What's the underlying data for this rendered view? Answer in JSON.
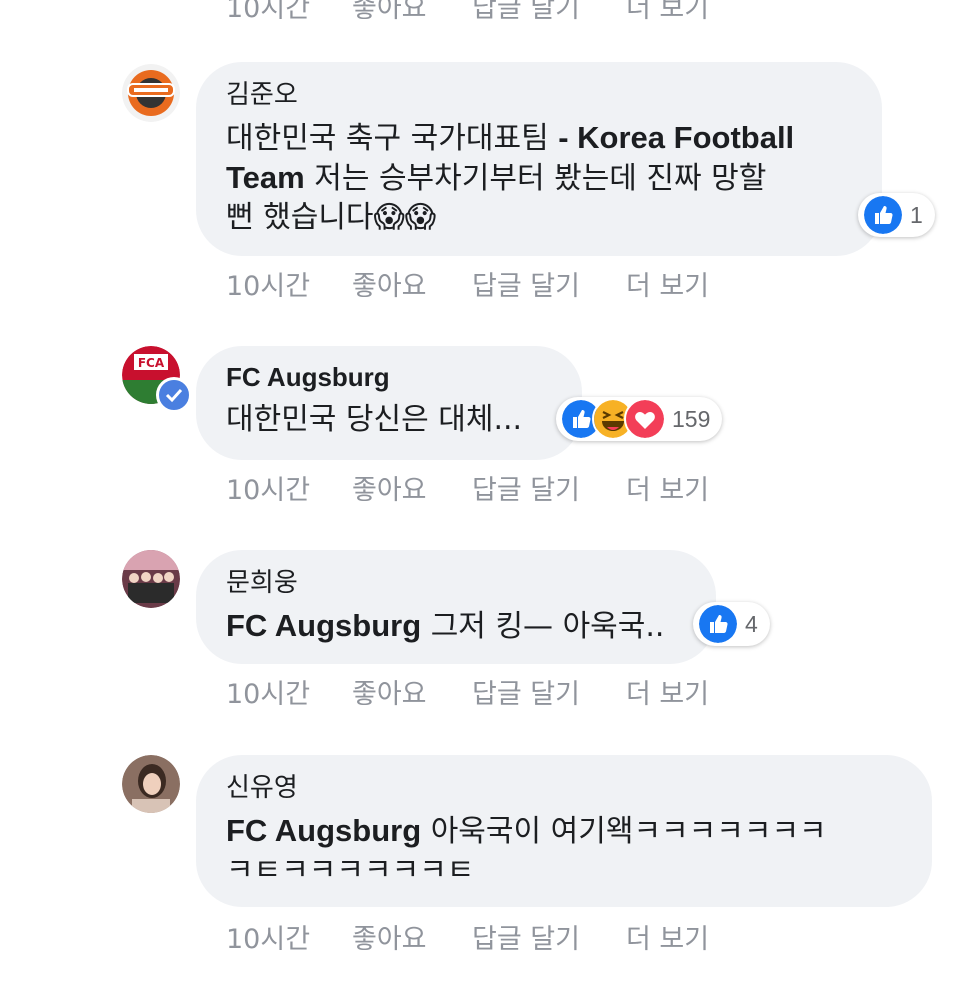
{
  "actions": {
    "time": "10시간",
    "like": "좋아요",
    "reply": "답글 달기",
    "more": "더 보기"
  },
  "comments": [
    {
      "author": "김준오",
      "tag": "대한민국 축구 국가대표팀 - Korea Football Team",
      "line1_plain": "대한민국 축구 국가대표팀 ",
      "line1_bold": "- Korea Football",
      "line2_bold": "Team",
      "line2_plain": " 저는 승부차기부터 봤는데 진짜 망할",
      "line3": "뻔 했습니다😱😱",
      "reaction_count": "1",
      "reactions": [
        "like-icon"
      ]
    },
    {
      "author": "FC Augsburg",
      "text": "대한민국 당신은 대체...",
      "reaction_count": "159",
      "reactions": [
        "like-icon",
        "haha-icon",
        "love-icon"
      ],
      "avatar_label": "FCA"
    },
    {
      "author": "문희웅",
      "tag": "FC Augsburg",
      "text": " 그저 킹— 아욱국..",
      "reaction_count": "4",
      "reactions": [
        "like-icon"
      ]
    },
    {
      "author": "신유영",
      "tag": "FC Augsburg",
      "line1": " 아욱국이 여기왝ㅋㅋㅋㅋㅋㅋㅋ",
      "line2": "ㅋㅌㅋㅋㅋㅋㅋㅋㅌ"
    }
  ],
  "colors": {
    "bubble": "#f0f2f5",
    "meta": "#90949c",
    "like": "#1877f2",
    "love": "#f33e58",
    "haha": "#f7b125"
  }
}
